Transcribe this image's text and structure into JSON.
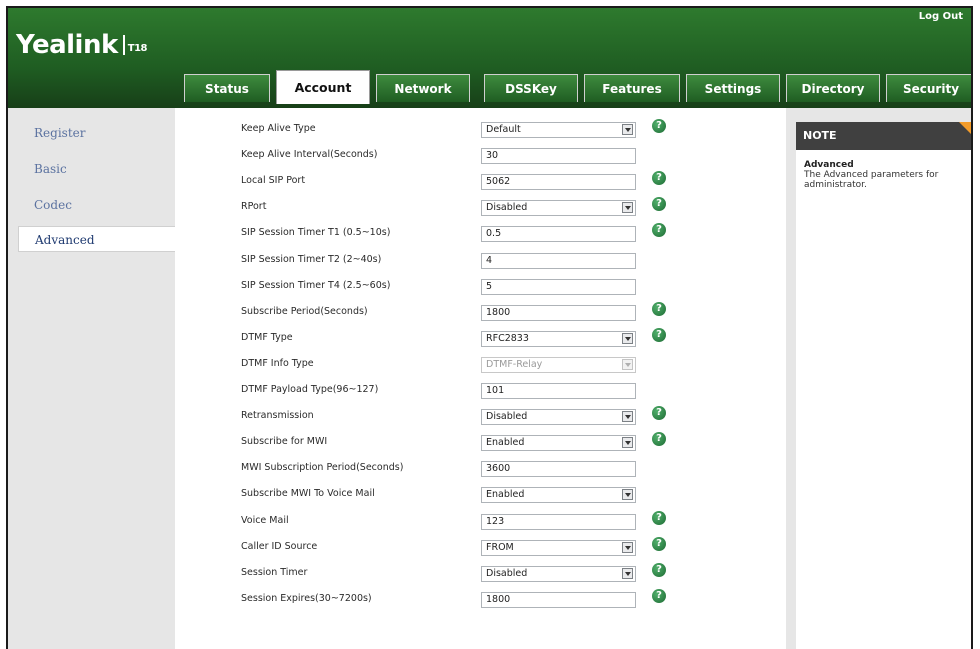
{
  "header": {
    "brand": "Yealink",
    "model": "T18",
    "logout_label": "Log Out"
  },
  "tabs": [
    {
      "label": "Status",
      "active": false
    },
    {
      "label": "Account",
      "active": true
    },
    {
      "label": "Network",
      "active": false
    },
    {
      "label": "DSSKey",
      "active": false
    },
    {
      "label": "Features",
      "active": false
    },
    {
      "label": "Settings",
      "active": false
    },
    {
      "label": "Directory",
      "active": false
    },
    {
      "label": "Security",
      "active": false
    }
  ],
  "sidebar": {
    "items": [
      {
        "label": "Register",
        "active": false
      },
      {
        "label": "Basic",
        "active": false
      },
      {
        "label": "Codec",
        "active": false
      },
      {
        "label": "Advanced",
        "active": true
      }
    ]
  },
  "form": {
    "rows": [
      {
        "label": "Keep Alive Type",
        "type": "select",
        "value": "Default",
        "help": true
      },
      {
        "label": "Keep Alive Interval(Seconds)",
        "type": "input",
        "value": "30",
        "help": false
      },
      {
        "label": "Local SIP Port",
        "type": "input",
        "value": "5062",
        "help": true
      },
      {
        "label": "RPort",
        "type": "select",
        "value": "Disabled",
        "help": true
      },
      {
        "label": "SIP Session Timer T1 (0.5~10s)",
        "type": "input",
        "value": "0.5",
        "help": true
      },
      {
        "label": "SIP Session Timer T2 (2~40s)",
        "type": "input",
        "value": "4",
        "help": false
      },
      {
        "label": "SIP Session Timer T4 (2.5~60s)",
        "type": "input",
        "value": "5",
        "help": false
      },
      {
        "label": "Subscribe Period(Seconds)",
        "type": "input",
        "value": "1800",
        "help": true
      },
      {
        "label": "DTMF Type",
        "type": "select",
        "value": "RFC2833",
        "help": true
      },
      {
        "label": "DTMF Info Type",
        "type": "select",
        "value": "DTMF-Relay",
        "help": false,
        "disabled": true
      },
      {
        "label": "DTMF Payload Type(96~127)",
        "type": "input",
        "value": "101",
        "help": false
      },
      {
        "label": "Retransmission",
        "type": "select",
        "value": "Disabled",
        "help": true
      },
      {
        "label": "Subscribe for MWI",
        "type": "select",
        "value": "Enabled",
        "help": true
      },
      {
        "label": "MWI Subscription Period(Seconds)",
        "type": "input",
        "value": "3600",
        "help": false
      },
      {
        "label": "Subscribe MWI To Voice Mail",
        "type": "select",
        "value": "Enabled",
        "help": false
      },
      {
        "label": "Voice Mail",
        "type": "input",
        "value": "123",
        "help": true
      },
      {
        "label": "Caller ID Source",
        "type": "select",
        "value": "FROM",
        "help": true
      },
      {
        "label": "Session Timer",
        "type": "select",
        "value": "Disabled",
        "help": true
      },
      {
        "label": "Session Expires(30~7200s)",
        "type": "input",
        "value": "1800",
        "help": true
      }
    ]
  },
  "note": {
    "heading": "NOTE",
    "title": "Advanced",
    "text": "The Advanced parameters for administrator."
  },
  "colors": {
    "header_green": "#1f5d22",
    "note_accent": "#f39c2a",
    "help_icon": "#2e8a46"
  }
}
